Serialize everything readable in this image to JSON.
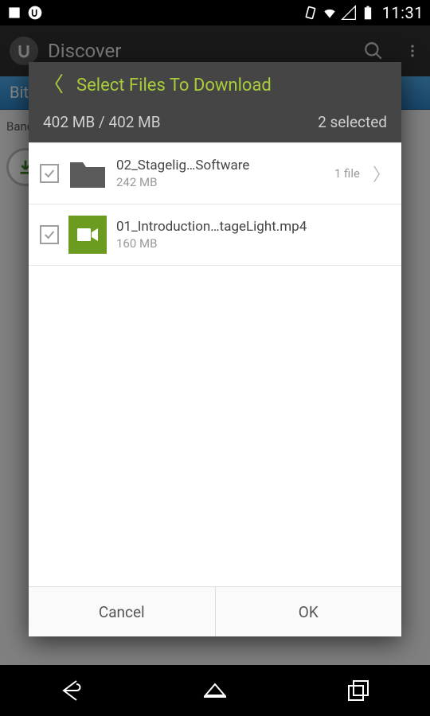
{
  "status": {
    "time": "11:31"
  },
  "bg": {
    "title": "Discover",
    "banner": "Bit",
    "label": "Band"
  },
  "dialog": {
    "title": "Select Files To Download",
    "size_summary": "402 MB / 402 MB",
    "selected_summary": "2 selected",
    "items": [
      {
        "name": "02_Stagelig…Software",
        "size": "242 MB",
        "count": "1 file",
        "type": "folder"
      },
      {
        "name": "01_Introduction…tageLight.mp4",
        "size": "160 MB",
        "type": "video"
      }
    ],
    "cancel": "Cancel",
    "ok": "OK"
  }
}
